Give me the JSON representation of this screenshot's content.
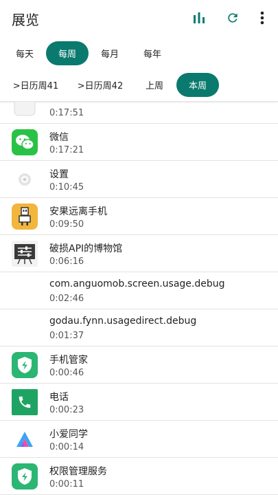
{
  "appbar": {
    "title": "展览",
    "actions": [
      "bar-chart-icon",
      "refresh-icon",
      "more-vert-icon"
    ],
    "accent": "#0a7a6e"
  },
  "period_tabs": [
    "每天",
    "每周",
    "每月",
    "每年"
  ],
  "period_selected": "每周",
  "week_tabs": [
    ">日历周41",
    ">日历周42",
    "上周",
    "本周"
  ],
  "week_selected": "本周",
  "apps": [
    {
      "name": "",
      "time": "0:17:51",
      "icon": "partial-app-icon"
    },
    {
      "name": "微信",
      "time": "0:17:21",
      "icon": "wechat-icon"
    },
    {
      "name": "设置",
      "time": "0:10:45",
      "icon": "settings-icon"
    },
    {
      "name": "安果远离手机",
      "time": "0:09:50",
      "icon": "robot-icon"
    },
    {
      "name": "破损API的博物馆",
      "time": "0:06:16",
      "icon": "sliders-icon"
    },
    {
      "name": "com.anguomob.screen.usage.debug",
      "time": "0:02:46",
      "icon": ""
    },
    {
      "name": "godau.fynn.usagedirect.debug",
      "time": "0:01:37",
      "icon": ""
    },
    {
      "name": "手机管家",
      "time": "0:00:46",
      "icon": "shield-bolt-icon"
    },
    {
      "name": "电话",
      "time": "0:00:23",
      "icon": "phone-icon"
    },
    {
      "name": "小爱同学",
      "time": "0:00:14",
      "icon": "xiaoai-icon"
    },
    {
      "name": "权限管理服务",
      "time": "0:00:11",
      "icon": "shield-bolt-icon"
    }
  ]
}
